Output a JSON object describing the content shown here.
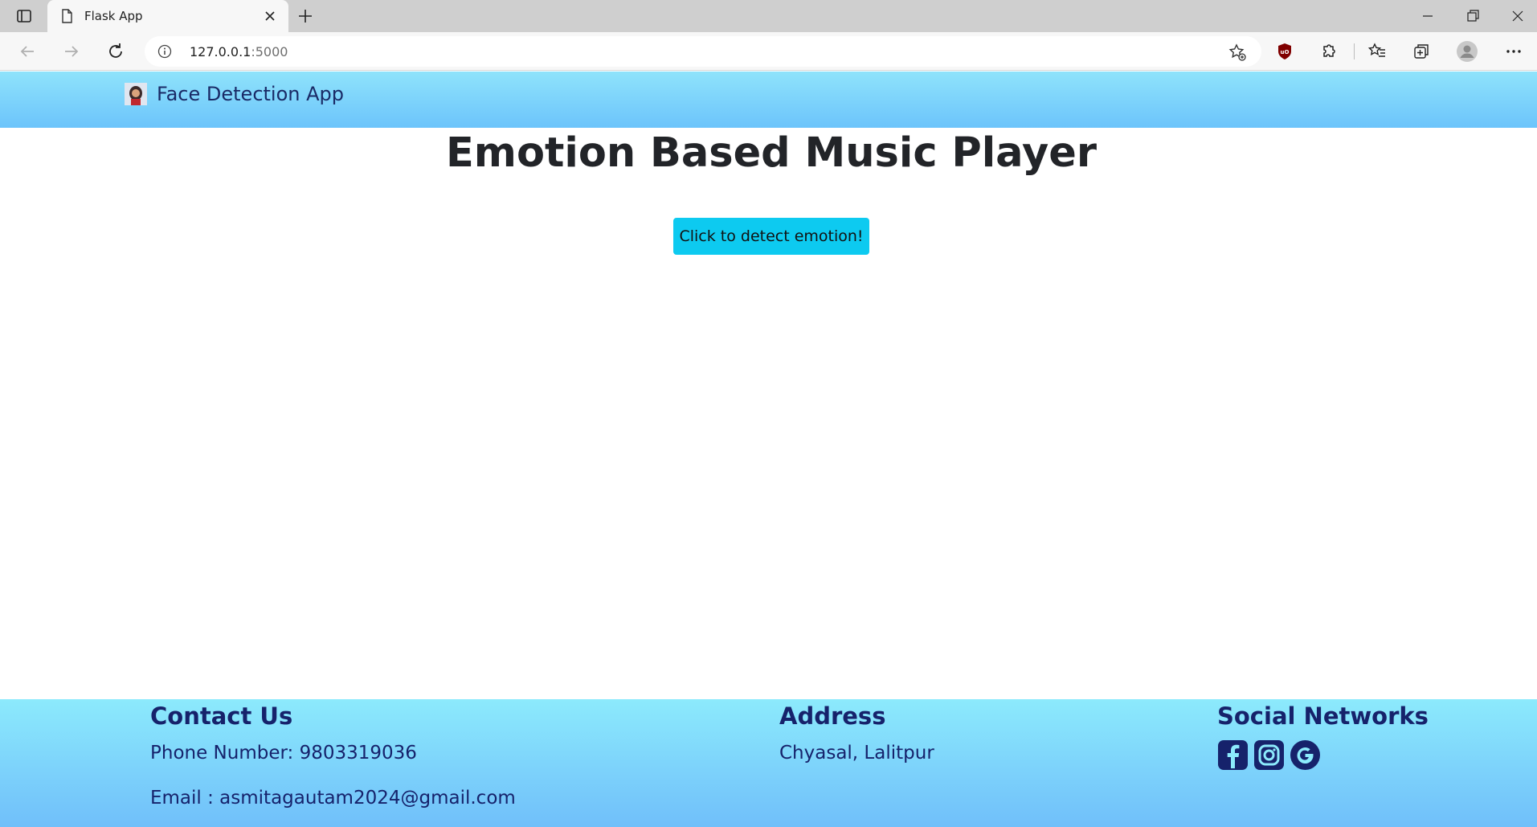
{
  "browser": {
    "tab_title": "Flask App",
    "url_host": "127.0.0.1",
    "url_port": ":5000",
    "icons": [
      "tab-actions-icon",
      "document-icon",
      "close-icon",
      "plus-icon",
      "minimize-icon",
      "restore-icon",
      "close-icon",
      "back-arrow-icon",
      "forward-arrow-icon",
      "refresh-icon",
      "info-icon",
      "add-favorite-icon",
      "ublock-icon",
      "extensions-icon",
      "favorites-icon",
      "collections-icon",
      "profile-avatar-icon",
      "more-icon"
    ]
  },
  "navbar": {
    "brand_name": "Face Detection App",
    "brand_icon": "face-logo-icon"
  },
  "main": {
    "heading": "Emotion Based Music Player",
    "detect_button": "Click to detect emotion!"
  },
  "footer": {
    "contact": {
      "title": "Contact Us",
      "phone": "Phone Number: 9803319036",
      "email": "Email : asmitagautam2024@gmail.com"
    },
    "address": {
      "title": "Address",
      "text": "Chyasal, Lalitpur"
    },
    "social": {
      "title": "Social Networks",
      "icons": [
        "facebook-icon",
        "instagram-icon",
        "google-icon"
      ]
    }
  },
  "colors": {
    "navbar_top": "#8fe3fb",
    "navbar_bottom": "#6cc4fb",
    "button_bg": "#0dcaf0",
    "footer_text": "#16226b",
    "heading_text": "#222428"
  }
}
